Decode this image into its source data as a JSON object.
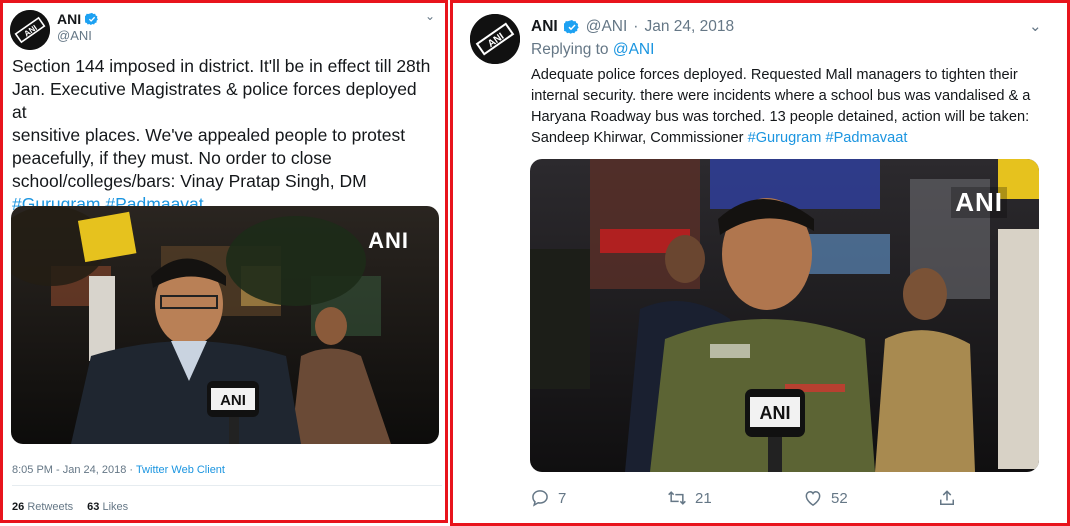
{
  "left_tweet": {
    "name": "ANI",
    "handle": "@ANI",
    "text_plain": "Section 144 imposed in district. It'll be in effect till 28th\nJan. Executive Magistrates & police forces deployed at\nsensitive places. We've appealed people to protest\npeacefully, if they must. No order to close\nschool/colleges/bars: Vinay Pratap Singh, DM\n",
    "hashtag_1": "#Gurugram",
    "hashtag_2": "#Padmaavat",
    "media_watermark": "ANI",
    "time": "8:05 PM - Jan 24, 2018",
    "separator": " · ",
    "source": "Twitter Web Client",
    "retweets_count": "26",
    "retweets_label": "Retweets",
    "likes_count": "63",
    "likes_label": "Likes"
  },
  "right_tweet": {
    "name": "ANI",
    "handle": "@ANI",
    "date_sep": "·",
    "date": "Jan 24, 2018",
    "replying_prefix": "Replying to",
    "replying_to": "@ANI",
    "text_plain": "Adequate police forces deployed. Requested Mall managers to tighten their\ninternal security. there were incidents where a school bus was vandalised & a\nHaryana Roadway bus was torched. 13 people detained, action will be taken:\nSandeep Khirwar, Commissioner ",
    "hashtag_1": "#Gurugram",
    "hashtag_2": "#Padmavaat",
    "media_watermark": "ANI",
    "replies": "7",
    "retweets": "21",
    "likes": "52"
  },
  "colors": {
    "border": "#e8141c",
    "link": "#1b95e0",
    "muted": "#657786",
    "text": "#14171a"
  },
  "icons": [
    "ani-logo-icon",
    "verified-badge-icon",
    "chevron-down-icon",
    "reply-icon",
    "retweet-icon",
    "like-icon",
    "share-icon"
  ]
}
